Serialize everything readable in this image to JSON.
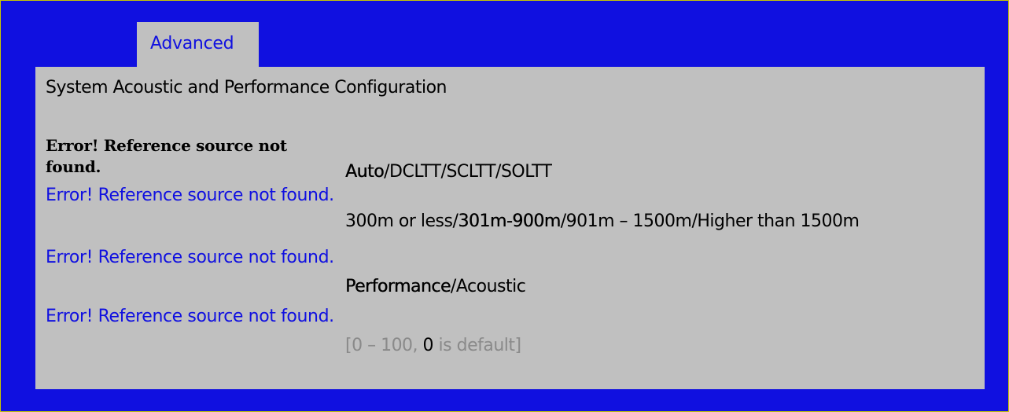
{
  "tabs": [
    {
      "label": "Advanced"
    }
  ],
  "page": {
    "title": "System Acoustic and Performance Configuration"
  },
  "settings": [
    {
      "label": "Error! Reference source not found.",
      "options": [
        "Auto",
        "DCLTT",
        "SCLTT",
        "SOLTT"
      ],
      "selected_index": 0
    },
    {
      "label": "Error! Reference source not found.",
      "options": [
        "300m or less",
        "301m-900m",
        "901m – 1500m",
        "Higher than 1500m"
      ],
      "selected_index": 1
    },
    {
      "label": "Error! Reference source not found.",
      "options": [
        "Performance",
        "Acoustic"
      ],
      "selected_index": 0
    },
    {
      "label": "Error! Reference source not found.",
      "range_prefix": "[0 – 100, ",
      "range_default": "0",
      "range_suffix": " is default]"
    }
  ],
  "colors": {
    "background": "#1010e0",
    "panel": "#c0c0c0",
    "label_blue": "#1010e0",
    "hint_grey": "#8a8a8a"
  }
}
